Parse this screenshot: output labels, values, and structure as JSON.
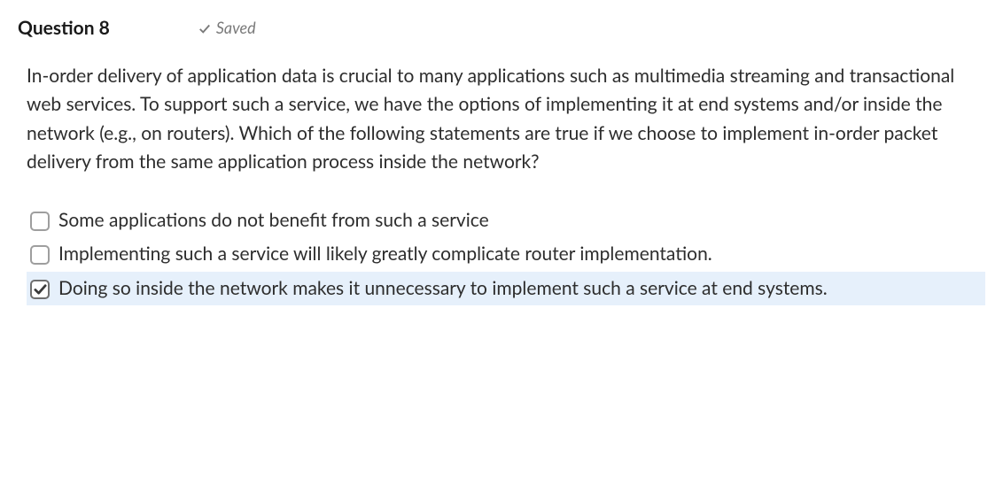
{
  "header": {
    "title": "Question 8",
    "saved_label": "Saved"
  },
  "question_text": "In-order delivery of application data is crucial to many applications such as multimedia streaming and transactional web services. To support such a service, we have the options of implementing it at end systems and/or inside the network (e.g., on routers). Which of the following statements are true if we choose to implement in-order packet delivery from the same application process inside the network?",
  "options": [
    {
      "label": "Some applications do not benefit from such a service",
      "checked": false,
      "highlighted": false
    },
    {
      "label": "Implementing such a service will likely greatly complicate router implementation.",
      "checked": false,
      "highlighted": false
    },
    {
      "label": "Doing so inside the network makes it unnecessary to implement such a service at end systems.",
      "checked": true,
      "highlighted": true
    }
  ]
}
